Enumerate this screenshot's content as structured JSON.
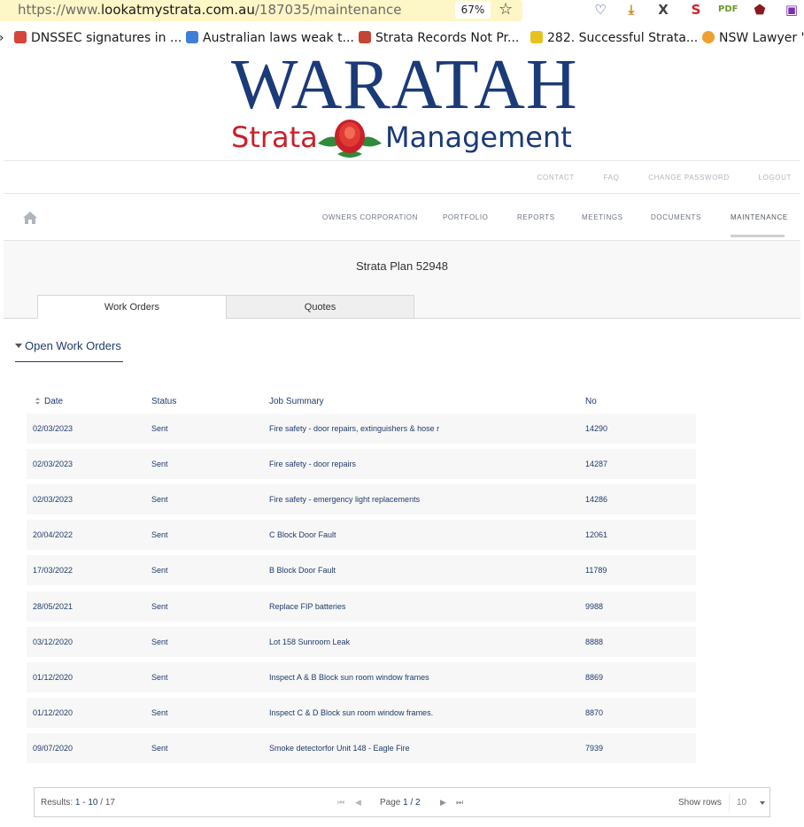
{
  "browser": {
    "url_prefix": "https://www.",
    "url_host": "lookatmystrata.com.au",
    "url_path": "/187035/maintenance",
    "zoom": "67%",
    "bookmarks": [
      {
        "label": "DNSSEC signatures in ...",
        "color": "#d6453a"
      },
      {
        "label": "Australian laws weak t...",
        "color": "#3f7fd6"
      },
      {
        "label": "Strata Records Not Pr...",
        "color": "#c44536"
      },
      {
        "label": "282. Successful Strata...",
        "color": "#e8c21c"
      },
      {
        "label": "NSW Lawyer 'S",
        "color": "#f0a030"
      }
    ]
  },
  "logo": {
    "word": "WARATAH",
    "strata": "Strata",
    "management": "Management"
  },
  "top_links": [
    "CONTACT",
    "FAQ",
    "CHANGE PASSWORD",
    "LOGOUT"
  ],
  "nav": [
    "OWNERS CORPORATION",
    "PORTFOLIO",
    "REPORTS",
    "MEETINGS",
    "DOCUMENTS",
    "MAINTENANCE"
  ],
  "plan_title": "Strata Plan 52948",
  "tabs": [
    "Work Orders",
    "Quotes"
  ],
  "section_title": "Open Work Orders",
  "table": {
    "headers": [
      "Date",
      "Status",
      "Job Summary",
      "No"
    ],
    "rows": [
      {
        "date": "02/03/2023",
        "status": "Sent",
        "summary": "Fire safety - door repairs, extinguishers & hose r",
        "no": "14290"
      },
      {
        "date": "02/03/2023",
        "status": "Sent",
        "summary": "Fire safety - door repairs",
        "no": "14287"
      },
      {
        "date": "02/03/2023",
        "status": "Sent",
        "summary": "Fire safety - emergency light replacements",
        "no": "14286"
      },
      {
        "date": "20/04/2022",
        "status": "Sent",
        "summary": "C Block Door Fault",
        "no": "12061"
      },
      {
        "date": "17/03/2022",
        "status": "Sent",
        "summary": "B Block Door Fault",
        "no": "11789"
      },
      {
        "date": "28/05/2021",
        "status": "Sent",
        "summary": "Replace FIP batteries",
        "no": "9988"
      },
      {
        "date": "03/12/2020",
        "status": "Sent",
        "summary": "Lot 158 Sunroom Leak",
        "no": "8888"
      },
      {
        "date": "01/12/2020",
        "status": "Sent",
        "summary": "Inspect A & B Block sun room window frames",
        "no": "8869"
      },
      {
        "date": "01/12/2020",
        "status": "Sent",
        "summary": "Inspect C & D Block sun room window frames.",
        "no": "8870"
      },
      {
        "date": "09/07/2020",
        "status": "Sent",
        "summary": "Smoke detectorfor Unit 148 - Eagle Fire",
        "no": "7939"
      }
    ]
  },
  "pager": {
    "results_label": "Results:",
    "results_range": "1 - 10",
    "results_total": "/ 17",
    "page_label": "Page",
    "page_current": "1 / 2",
    "show_rows_label": "Show rows",
    "show_rows_value": "10"
  }
}
